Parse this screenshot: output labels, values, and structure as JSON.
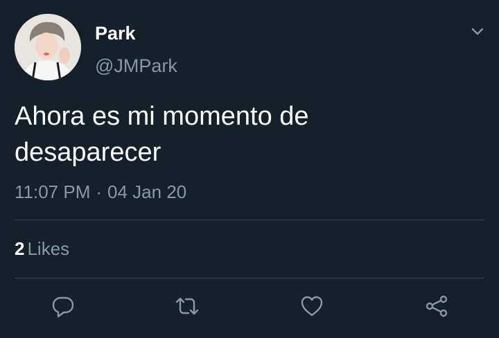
{
  "user": {
    "display_name": "Park",
    "handle": "@JMPark"
  },
  "tweet": {
    "text": "Ahora es mi momento de\ndesaparecer",
    "time": "11:07 PM",
    "separator": "·",
    "date": "04 Jan 20"
  },
  "stats": {
    "likes_count": "2",
    "likes_label": "Likes"
  },
  "icons": {
    "menu": "chevron-down-icon",
    "reply": "reply-icon",
    "retweet": "retweet-icon",
    "like": "heart-icon",
    "share": "share-icon"
  },
  "colors": {
    "background": "#15202b",
    "primary_text": "#ffffff",
    "secondary_text": "#8899a6",
    "divider": "#38444d"
  }
}
